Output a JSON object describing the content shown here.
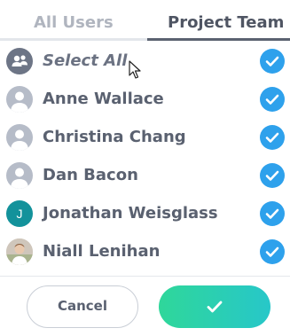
{
  "tabs": {
    "all_users": "All Users",
    "project_team": "Project Team",
    "active": "Project Team"
  },
  "list": {
    "select_all": {
      "label": "Select All",
      "checked": true,
      "icon": "group-icon"
    },
    "users": [
      {
        "name": "Anne Wallace",
        "avatar": "default-user-icon",
        "checked": true
      },
      {
        "name": "Christina Chang",
        "avatar": "default-user-icon",
        "checked": true
      },
      {
        "name": "Dan Bacon",
        "avatar": "default-user-icon",
        "checked": true
      },
      {
        "name": "Jonathan Weisglass",
        "avatar": "initial",
        "initial": "J",
        "checked": true
      },
      {
        "name": "Niall Lenihan",
        "avatar": "photo",
        "checked": true
      }
    ]
  },
  "footer": {
    "cancel_label": "Cancel",
    "confirm_icon": "checkmark-icon"
  },
  "colors": {
    "check_blue": "#2ea1ec",
    "confirm_gradient_start": "#2fd79a",
    "confirm_gradient_end": "#27c7c9",
    "initial_avatar": "#13929b"
  }
}
